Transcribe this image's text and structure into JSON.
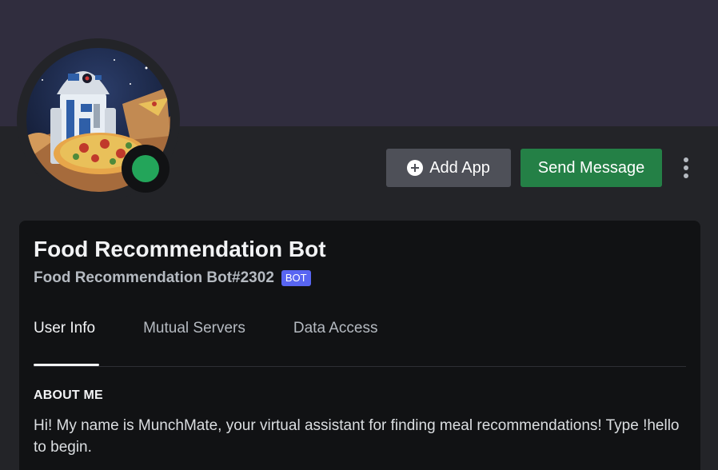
{
  "profile": {
    "display_name": "Food Recommendation Bot",
    "username": "Food Recommendation Bot#2302",
    "bot_tag": "BOT",
    "status": "online",
    "avatar_icon": "robot-with-pizza-avatar"
  },
  "actions": {
    "add_app_label": "Add App",
    "add_app_icon": "plus-circle-icon",
    "send_message_label": "Send Message",
    "more_icon": "vertical-ellipsis-icon"
  },
  "tabs": [
    {
      "label": "User Info",
      "active": true
    },
    {
      "label": "Mutual Servers",
      "active": false
    },
    {
      "label": "Data Access",
      "active": false
    }
  ],
  "about": {
    "title": "ABOUT ME",
    "text": "Hi! My name is MunchMate, your virtual assistant for finding meal recommendations! Type !hello to begin."
  },
  "colors": {
    "banner": "#302d3e",
    "background": "#232428",
    "card": "#111214",
    "add_button": "#4e5058",
    "send_button": "#248046",
    "status_online": "#23a55a",
    "bot_tag": "#5865f2"
  }
}
